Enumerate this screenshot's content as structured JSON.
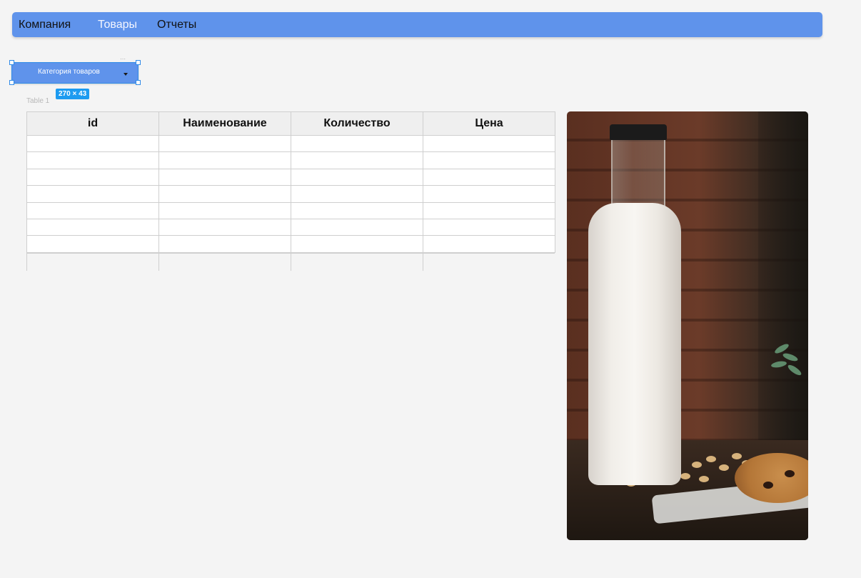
{
  "navbar": {
    "items": [
      {
        "label": "Компания"
      },
      {
        "label": "Товары"
      },
      {
        "label": "Отчеты"
      }
    ]
  },
  "category_dropdown": {
    "label": "Категория товаров",
    "size_badge": "270 × 43"
  },
  "table": {
    "caption": "Table 1",
    "headers": [
      "id",
      "Наименование",
      "Количество",
      "Цена"
    ],
    "rows": [
      [
        "",
        "",
        "",
        ""
      ],
      [
        "",
        "",
        "",
        ""
      ],
      [
        "",
        "",
        "",
        ""
      ],
      [
        "",
        "",
        "",
        ""
      ],
      [
        "",
        "",
        "",
        ""
      ],
      [
        "",
        "",
        "",
        ""
      ],
      [
        "",
        "",
        "",
        ""
      ]
    ]
  },
  "photo": {
    "icon": "milk-bottle-photo"
  },
  "colors": {
    "accent": "#5f93eb",
    "selection": "#1d9bf0",
    "background": "#f4f4f4"
  }
}
